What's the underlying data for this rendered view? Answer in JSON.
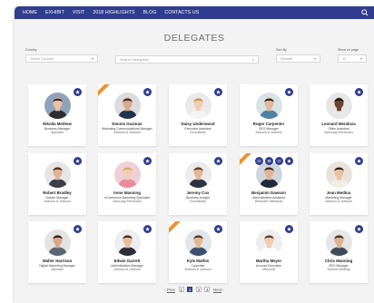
{
  "nav": {
    "items": [
      "HOME",
      "EXHIBIT",
      "VISIT",
      "2018 HIGHLIGHTS",
      "BLOG",
      "CONTACTS US"
    ]
  },
  "page_title": "DELEGATES",
  "filters": {
    "country_label": "Country",
    "country_value": "Select Country",
    "search_placeholder": "Search Delegates",
    "sort_label": "Sort By",
    "sort_value": "Newest",
    "show_label": "Show on page",
    "show_value": "12"
  },
  "delegates": [
    {
      "name": "Nikolia Methew",
      "role": "Business Manager",
      "company": "Alphabet",
      "photo_bg": "#8fa3b8",
      "skin": "#e9c2a4",
      "hair": "#3a2a22",
      "shirt": "#2d2d2d",
      "badge": "star",
      "ribbon": false
    },
    {
      "name": "Dennis Guzman",
      "role": "Marketing Communications Manager",
      "company": "Johnson & Johnson",
      "photo_bg": "#dcdcdc",
      "skin": "#d9a98a",
      "hair": "#3b2b20",
      "shirt": "#23324f",
      "badge": "star",
      "ribbon": true
    },
    {
      "name": "Daisy Underwood",
      "role": "Executive Assistant",
      "company": "ExxonMobil",
      "photo_bg": "#eaeaea",
      "skin": "#f0cdb4",
      "hair": "#c99a4f",
      "shirt": "#f4f4f4",
      "badge": "star",
      "ribbon": false
    },
    {
      "name": "Roger Carpenter",
      "role": "SEO Manager",
      "company": "Johnson & Johnson",
      "photo_bg": "#d9e4e6",
      "skin": "#e3b89b",
      "hair": "#2b211b",
      "shirt": "#4f82a0",
      "badge": "star",
      "ribbon": false
    },
    {
      "name": "Leonard Mendoza",
      "role": "Office Assistant",
      "company": "Samsung Electronics",
      "photo_bg": "#e6e6e6",
      "skin": "#6b4532",
      "hair": "#1c1410",
      "shirt": "#e8e8e8",
      "badge": "star",
      "ribbon": false
    },
    {
      "name": "Robert Bradley",
      "role": "Branch Manager",
      "company": "Johnson & Johnson",
      "photo_bg": "#e6e6e6",
      "skin": "#e0b392",
      "hair": "#4a3526",
      "shirt": "#3a3f4a",
      "badge": "star",
      "ribbon": false
    },
    {
      "name": "Irene Manning",
      "role": "eCommerce Marketing Specialist",
      "company": "Samsung Electronics",
      "photo_bg": "#f0d0d6",
      "skin": "#f2cdb5",
      "hair": "#d6a86a",
      "shirt": "#e98b9e",
      "badge": "star",
      "ribbon": false
    },
    {
      "name": "Jeremy Cox",
      "role": "Business Analyst",
      "company": "ExxonMobil",
      "photo_bg": "#ececec",
      "skin": "#e2b697",
      "hair": "#5a4030",
      "shirt": "#2c3340",
      "badge": "star",
      "ribbon": false
    },
    {
      "name": "Benjamin Dawson",
      "role": "Administrative Assistant",
      "company": "Berkshire Hathaway",
      "photo_bg": "#cfd6dd",
      "skin": "#e0b394",
      "hair": "#3a2b22",
      "shirt": "#1f2a3a",
      "badge": "multi",
      "ribbon": true
    },
    {
      "name": "Jean Medina",
      "role": "Marketing Manager",
      "company": "Johnson & Johnson",
      "photo_bg": "#e9e3dc",
      "skin": "#e9c1a2",
      "hair": "#2e2017",
      "shirt": "#f1ece4",
      "badge": "star",
      "ribbon": false
    },
    {
      "name": "Walter Harrison",
      "role": "Digital Marketing Manager",
      "company": "Alphabet",
      "photo_bg": "#e3e3e3",
      "skin": "#d9a98a",
      "hair": "#2c221b",
      "shirt": "#5b6773",
      "badge": "star",
      "ribbon": false
    },
    {
      "name": "Edwin Garrett",
      "role": "Administrative Manager",
      "company": "Johnson & Johnson",
      "photo_bg": "#eeeeee",
      "skin": "#e7bd9e",
      "hair": "#3c2c22",
      "shirt": "#2a2f38",
      "badge": "star",
      "ribbon": false
    },
    {
      "name": "Kyle Mathis",
      "role": "Carpenter",
      "company": "Johnson & Johnson",
      "photo_bg": "#e0e6ea",
      "skin": "#e4b896",
      "hair": "#4c3728",
      "shirt": "#3d4f6e",
      "badge": "star",
      "ribbon": true
    },
    {
      "name": "Martha Meyer",
      "role": "Account Executive",
      "company": "Microsoft",
      "photo_bg": "#eeeeee",
      "skin": "#efcbb1",
      "hair": "#5b3a26",
      "shirt": "#ffffff",
      "badge": "star",
      "ribbon": false
    },
    {
      "name": "Chris Manning",
      "role": "SEO Manager",
      "company": "Tencent Holdings",
      "photo_bg": "#e6e6e6",
      "skin": "#e0b291",
      "hair": "#3d2e24",
      "shirt": "#414a57",
      "badge": "star",
      "ribbon": false
    }
  ],
  "pager": {
    "prev": "Prev",
    "pages": [
      "1",
      "2",
      "3",
      "4"
    ],
    "active": "2",
    "next": "Next"
  },
  "colors": {
    "nav": "#2f3d8f",
    "ribbon": "#f0922b",
    "badge": "#2f3d8f"
  }
}
